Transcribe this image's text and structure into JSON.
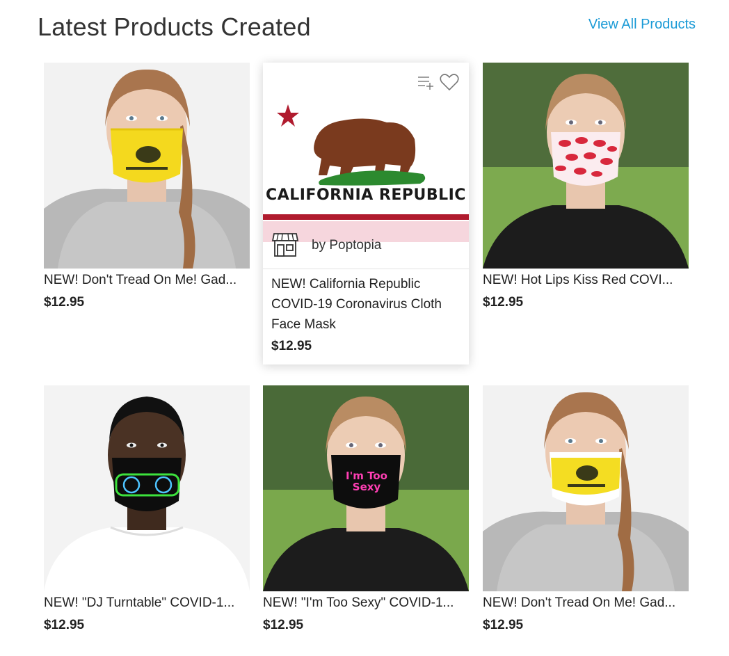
{
  "header": {
    "title": "Latest Products Created",
    "view_all": "View All Products"
  },
  "colors": {
    "link": "#1a9ad6",
    "text": "#212121"
  },
  "products": [
    {
      "name": "NEW! Don't Tread On Me! Gad...",
      "price": "$12.95"
    },
    {
      "name": "NEW! California Republic COVID-19 Coronavirus Cloth Face Mask",
      "price": "$12.95",
      "flag_text": "CALIFORNIA REPUBLIC",
      "store": "by Poptopia"
    },
    {
      "name": "NEW! Hot Lips Kiss Red COVI...",
      "price": "$12.95"
    },
    {
      "name": "NEW! \"DJ Turntable\" COVID-1...",
      "price": "$12.95"
    },
    {
      "name": "NEW! \"I'm Too Sexy\" COVID-1...",
      "price": "$12.95",
      "mask_text": "I'm Too Sexy"
    },
    {
      "name": "NEW! Don't Tread On Me! Gad...",
      "price": "$12.95"
    }
  ],
  "icons": [
    "add-to-collection-icon",
    "heart-icon",
    "store-icon"
  ]
}
